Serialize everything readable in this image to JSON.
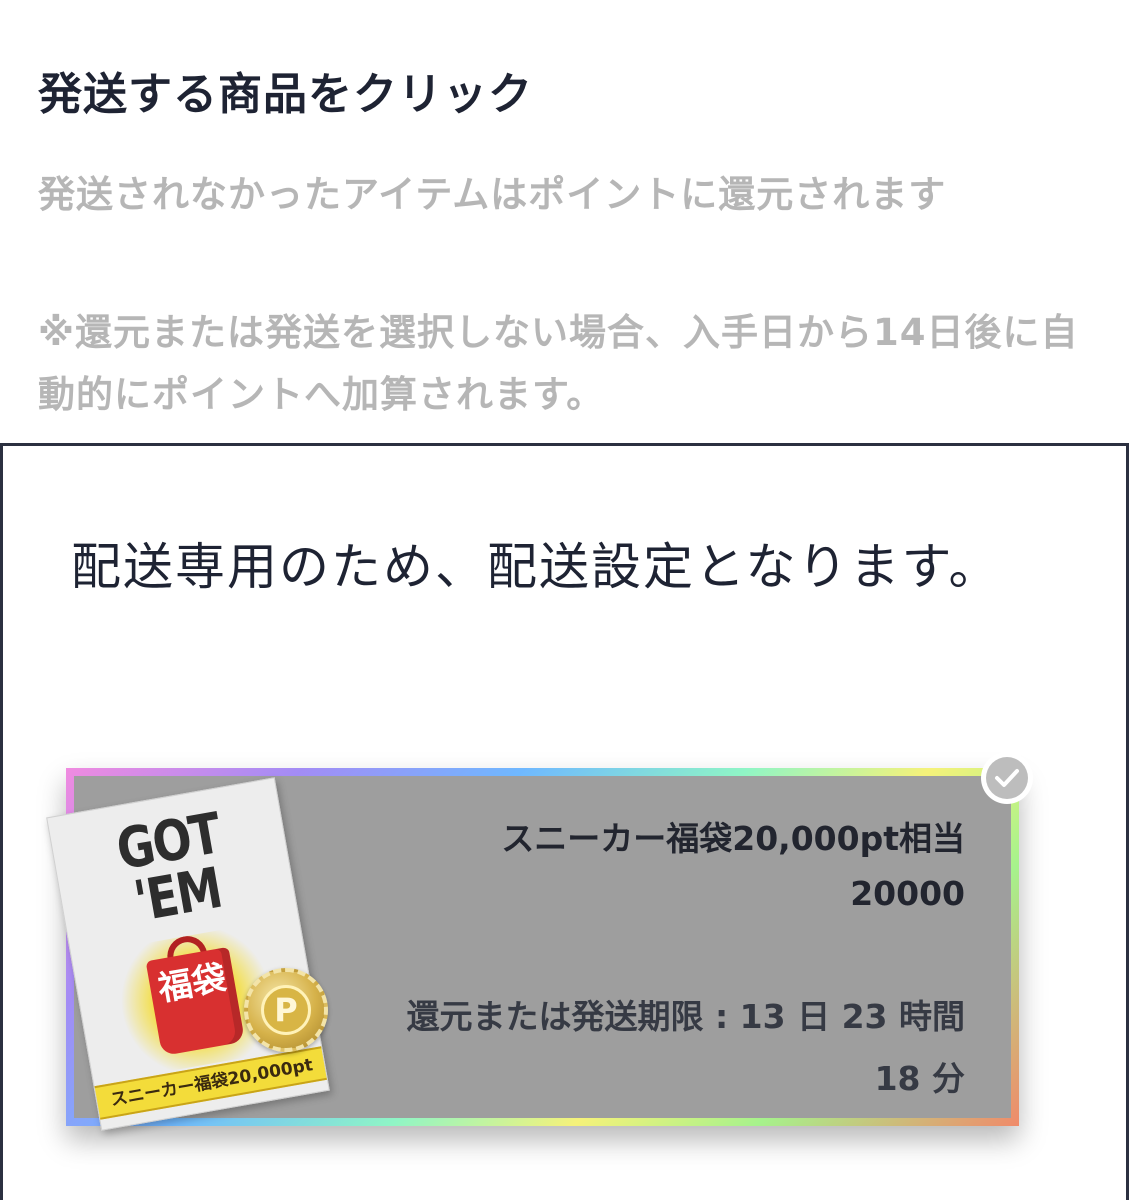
{
  "header": {
    "title": "発送する商品をクリック",
    "info_line1": "発送されなかったアイテムはポイントに還元されます",
    "info_line2": "※還元または発送を選択しない場合、入手日から14日後に自動的にポイントへ加算されます。"
  },
  "modal": {
    "message": "配送専用のため、配送設定となります。"
  },
  "item": {
    "name": "スニーカー福袋20,000pt相当",
    "points": "20000",
    "deadline_line1": "還元または発送期限 : 13 日 23 時間",
    "deadline_line2": "18 分",
    "selected": true,
    "thumbnail": {
      "logo": "GOT 'EM",
      "bag_text": "福袋",
      "banner": "スニーカー福袋20,000pt",
      "coin_label": "P"
    },
    "icon": "check-icon"
  },
  "colors": {
    "title": "#1e2333",
    "muted_text": "#b6b6b6",
    "card_bg": "#9e9e9e",
    "check_badge": "#bdbdbd"
  }
}
